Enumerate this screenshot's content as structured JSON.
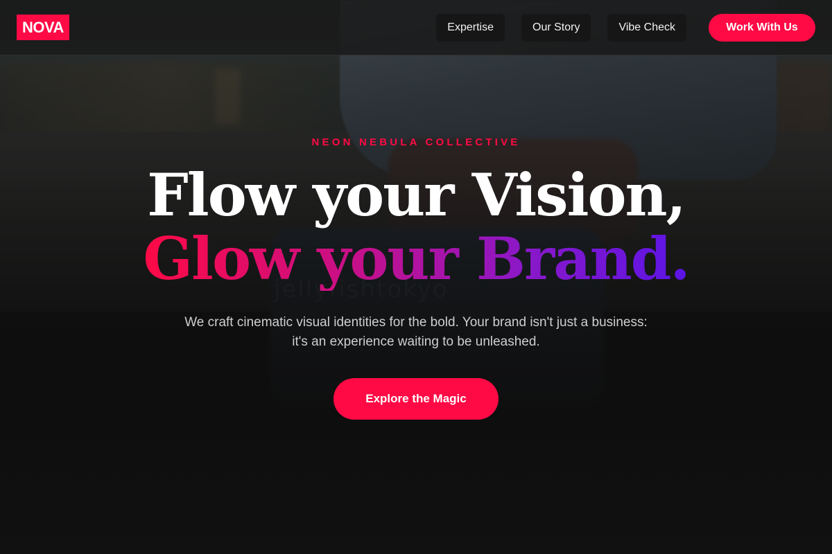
{
  "brand": {
    "logo_text": "NOVA",
    "accent_color": "#ff0a45"
  },
  "nav": {
    "items": [
      {
        "label": "Expertise"
      },
      {
        "label": "Our Story"
      },
      {
        "label": "Vibe Check"
      }
    ],
    "cta_label": "Work With Us"
  },
  "hero": {
    "eyebrow": "NEON NEBULA COLLECTIVE",
    "headline_line1": "Flow your Vision,",
    "headline_line2": "Glow your Brand.",
    "headline_gradient": [
      "#ff0a45",
      "#c4108c",
      "#8a18c8",
      "#5a14e6"
    ],
    "subtitle": "We craft cinematic visual identities for the bold. Your brand isn't just a business: it's an experience waiting to be unleashed.",
    "cta_label": "Explore the Magic",
    "background_watermark": "jellyfishtokyo"
  }
}
